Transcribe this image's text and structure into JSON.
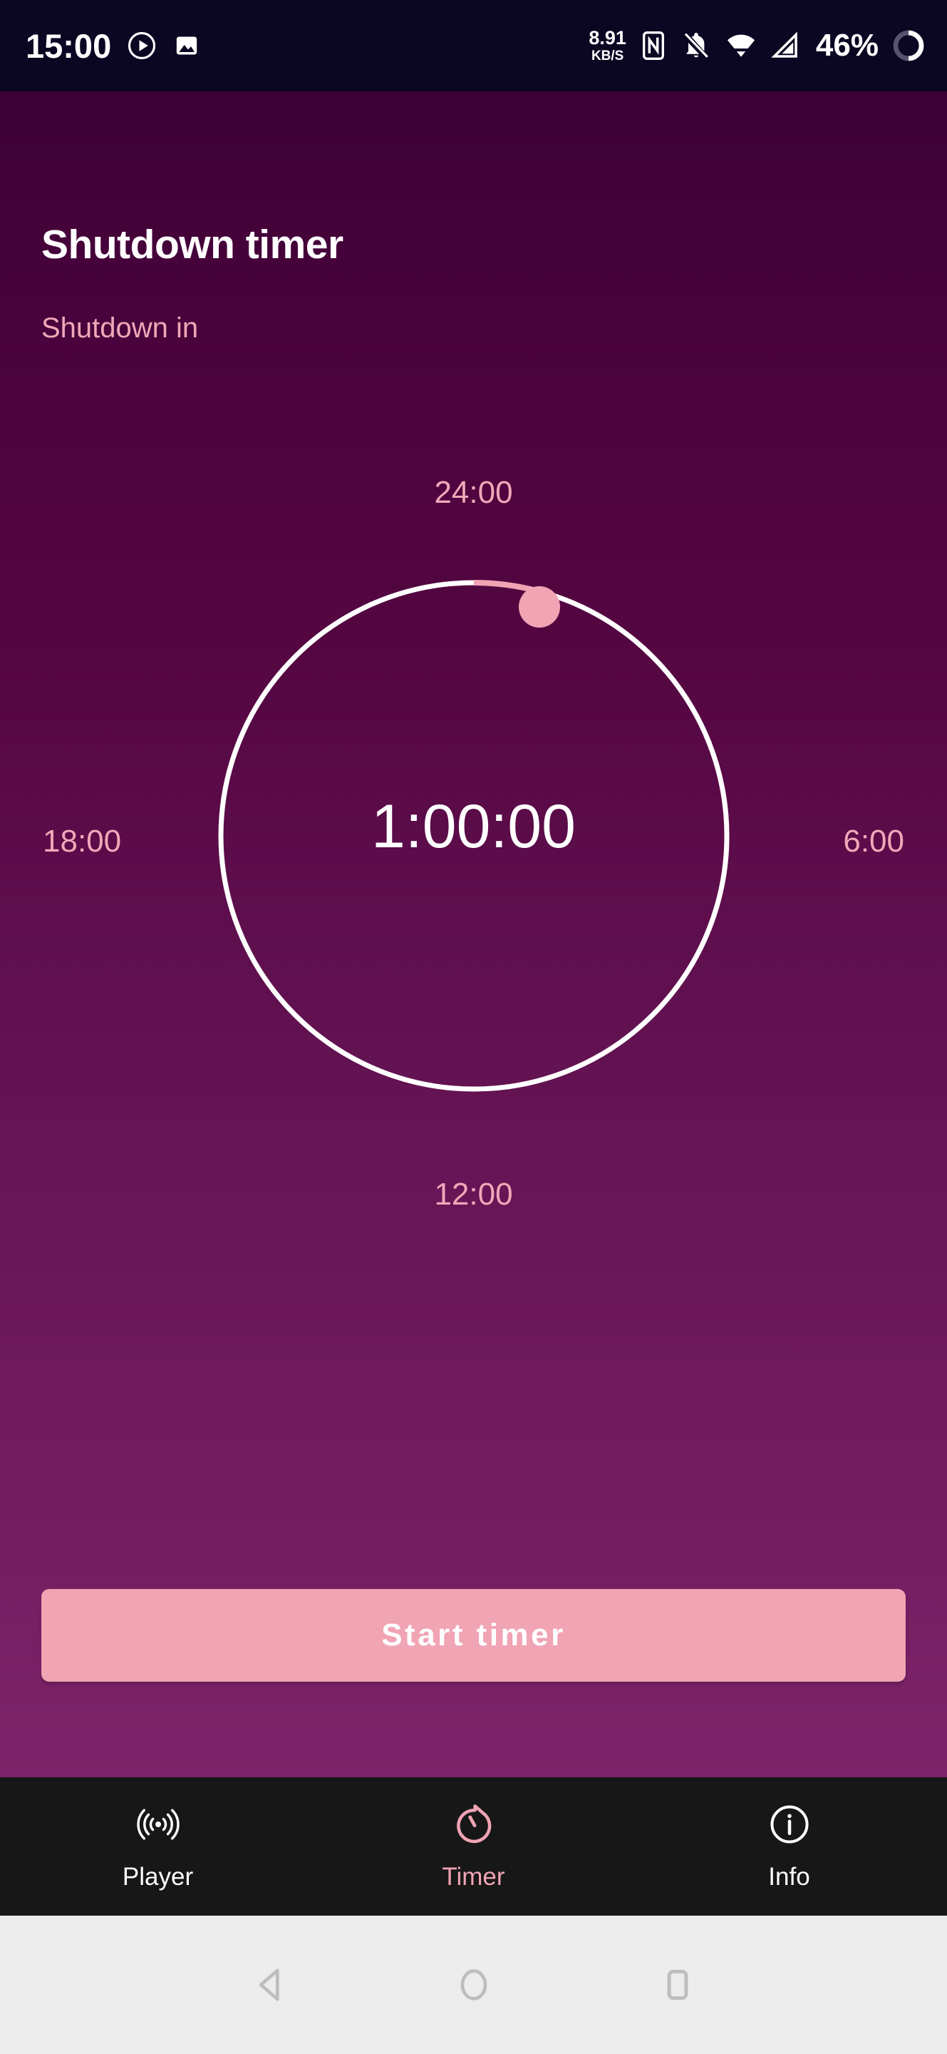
{
  "status_bar": {
    "clock": "15:00",
    "icons_left": [
      "play-circle-icon",
      "image-icon"
    ],
    "network_rate": "8.91",
    "network_unit": "KB/S",
    "icons_right": [
      "nfc-icon",
      "notifications-off-icon",
      "wifi-icon",
      "signal-icon"
    ],
    "battery_percent": "46%",
    "battery_icon": "battery-ring-icon",
    "background": "#0b0622"
  },
  "app": {
    "title": "Shutdown timer",
    "subtitle": "Shutdown in",
    "accent_color": "#f0a4b4",
    "background_top": "#3d0035",
    "background_bottom": "#7d2369"
  },
  "dial": {
    "center_time": "1:00:00",
    "tick_top": "24:00",
    "tick_right": "6:00",
    "tick_bottom": "12:00",
    "tick_left": "18:00",
    "track_color": "#ffffff",
    "progress_color": "#f0a4b4",
    "knob_color": "#f0a4b4",
    "selected_minutes": 60,
    "max_minutes": 1440,
    "progress_fraction": 0.0417
  },
  "actions": {
    "start_timer_label": "Start timer"
  },
  "bottom_nav": {
    "items": [
      {
        "label": "Player",
        "icon": "broadcast-icon",
        "active": false
      },
      {
        "label": "Timer",
        "icon": "timer-icon",
        "active": true
      },
      {
        "label": "Info",
        "icon": "info-circle-icon",
        "active": false
      }
    ]
  },
  "android_nav": {
    "back": "back-triangle-icon",
    "home": "home-circle-icon",
    "recents": "recents-square-icon"
  }
}
